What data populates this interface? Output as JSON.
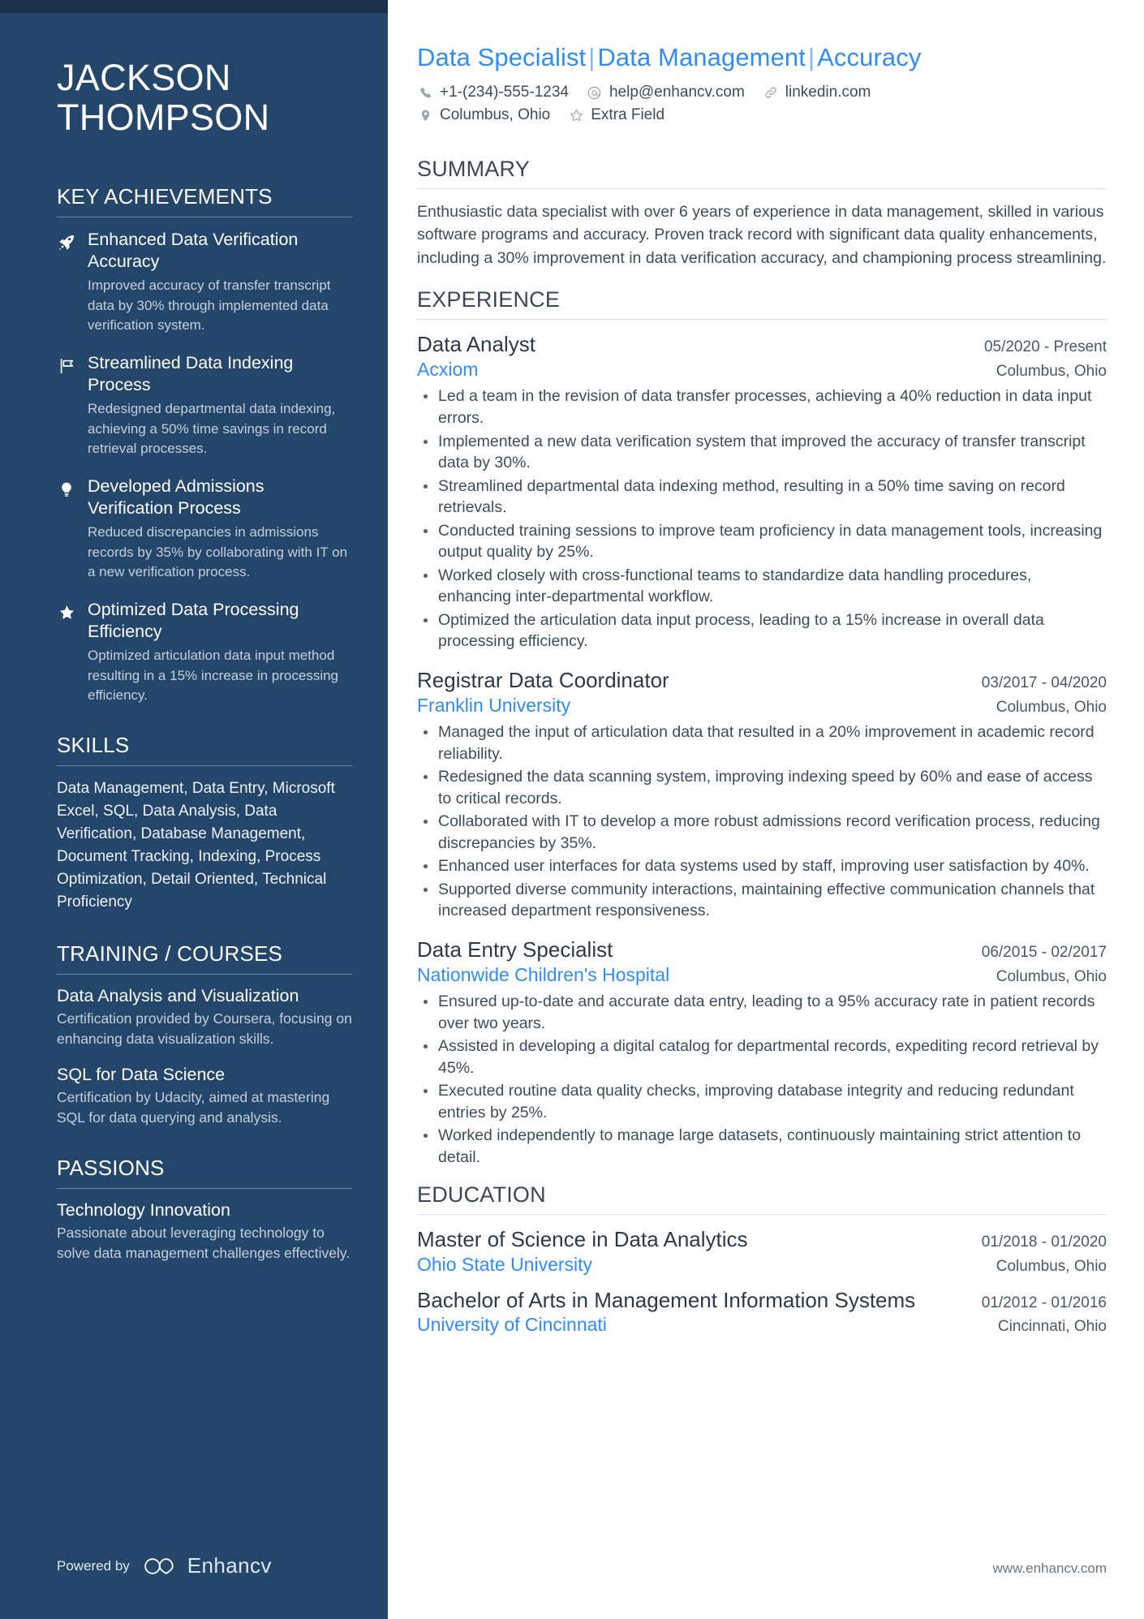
{
  "sidebar": {
    "name_first": "JACKSON",
    "name_last": "THOMPSON",
    "achievements_heading": "KEY ACHIEVEMENTS",
    "achievements": [
      {
        "icon": "rocket-icon",
        "title": "Enhanced Data Verification Accuracy",
        "desc": "Improved accuracy of transfer transcript data by 30% through implemented data verification system."
      },
      {
        "icon": "flag-icon",
        "title": "Streamlined Data Indexing Process",
        "desc": "Redesigned departmental data indexing, achieving a 50% time savings in record retrieval processes."
      },
      {
        "icon": "lightbulb-icon",
        "title": "Developed Admissions Verification Process",
        "desc": "Reduced discrepancies in admissions records by 35% by collaborating with IT on a new verification process."
      },
      {
        "icon": "star-icon",
        "title": "Optimized Data Processing Efficiency",
        "desc": "Optimized articulation data input method resulting in a 15% increase in processing efficiency."
      }
    ],
    "skills_heading": "SKILLS",
    "skills_text": "Data Management, Data Entry, Microsoft Excel, SQL, Data Analysis, Data Verification, Database Management, Document Tracking, Indexing, Process Optimization, Detail Oriented, Technical Proficiency",
    "training_heading": "TRAINING / COURSES",
    "courses": [
      {
        "title": "Data Analysis and Visualization",
        "desc": "Certification provided by Coursera, focusing on enhancing data visualization skills."
      },
      {
        "title": "SQL for Data Science",
        "desc": "Certification by Udacity, aimed at mastering SQL for data querying and analysis."
      }
    ],
    "passions_heading": "PASSIONS",
    "passions": [
      {
        "title": "Technology Innovation",
        "desc": "Passionate about leveraging technology to solve data management challenges effectively."
      }
    ],
    "powered_by_label": "Powered by",
    "powered_by_brand": "Enhancv"
  },
  "main": {
    "headline_parts": [
      "Data Specialist",
      "Data Management",
      "Accuracy"
    ],
    "headline_separator": "|",
    "contact_row1": [
      {
        "icon": "phone-icon",
        "text": "+1-(234)-555-1234"
      },
      {
        "icon": "at-icon",
        "text": "help@enhancv.com"
      },
      {
        "icon": "link-icon",
        "text": "linkedin.com"
      }
    ],
    "contact_row2": [
      {
        "icon": "location-pin-icon",
        "text": "Columbus, Ohio"
      },
      {
        "icon": "star-outline-icon",
        "text": "Extra Field"
      }
    ],
    "summary_heading": "SUMMARY",
    "summary_text": "Enthusiastic data specialist with over 6 years of experience in data management, skilled in various software programs and accuracy. Proven track record with significant data quality enhancements, including a 30% improvement in data verification accuracy, and championing process streamlining.",
    "experience_heading": "EXPERIENCE",
    "experience": [
      {
        "title": "Data Analyst",
        "date": "05/2020 - Present",
        "org": "Acxiom",
        "location": "Columbus, Ohio",
        "bullets": [
          "Led a team in the revision of data transfer processes, achieving a 40% reduction in data input errors.",
          "Implemented a new data verification system that improved the accuracy of transfer transcript data by 30%.",
          "Streamlined departmental data indexing method, resulting in a 50% time saving on record retrievals.",
          "Conducted training sessions to improve team proficiency in data management tools, increasing output quality by 25%.",
          "Worked closely with cross-functional teams to standardize data handling procedures, enhancing inter-departmental workflow.",
          "Optimized the articulation data input process, leading to a 15% increase in overall data processing efficiency."
        ]
      },
      {
        "title": "Registrar Data Coordinator",
        "date": "03/2017 - 04/2020",
        "org": "Franklin University",
        "location": "Columbus, Ohio",
        "bullets": [
          "Managed the input of articulation data that resulted in a 20% improvement in academic record reliability.",
          "Redesigned the data scanning system, improving indexing speed by 60% and ease of access to critical records.",
          "Collaborated with IT to develop a more robust admissions record verification process, reducing discrepancies by 35%.",
          "Enhanced user interfaces for data systems used by staff, improving user satisfaction by 40%.",
          "Supported diverse community interactions, maintaining effective communication channels that increased department responsiveness."
        ]
      },
      {
        "title": "Data Entry Specialist",
        "date": "06/2015 - 02/2017",
        "org": "Nationwide Children's Hospital",
        "location": "Columbus, Ohio",
        "bullets": [
          "Ensured up-to-date and accurate data entry, leading to a 95% accuracy rate in patient records over two years.",
          "Assisted in developing a digital catalog for departmental records, expediting record retrieval by 45%.",
          "Executed routine data quality checks, improving database integrity and reducing redundant entries by 25%.",
          "Worked independently to manage large datasets, continuously maintaining strict attention to detail."
        ]
      }
    ],
    "education_heading": "EDUCATION",
    "education": [
      {
        "degree": "Master of Science in Data Analytics",
        "date": "01/2018 - 01/2020",
        "school": "Ohio State University",
        "location": "Columbus, Ohio"
      },
      {
        "degree": "Bachelor of Arts in Management Information Systems",
        "date": "01/2012 - 01/2016",
        "school": "University of Cincinnati",
        "location": "Cincinnati, Ohio"
      }
    ],
    "site_url": "www.enhancv.com"
  },
  "colors": {
    "sidebar_bg": "#23466a",
    "sidebar_topbar": "#1b3049",
    "accent_blue": "#2f8df6",
    "body_text": "#3e4c5a"
  }
}
